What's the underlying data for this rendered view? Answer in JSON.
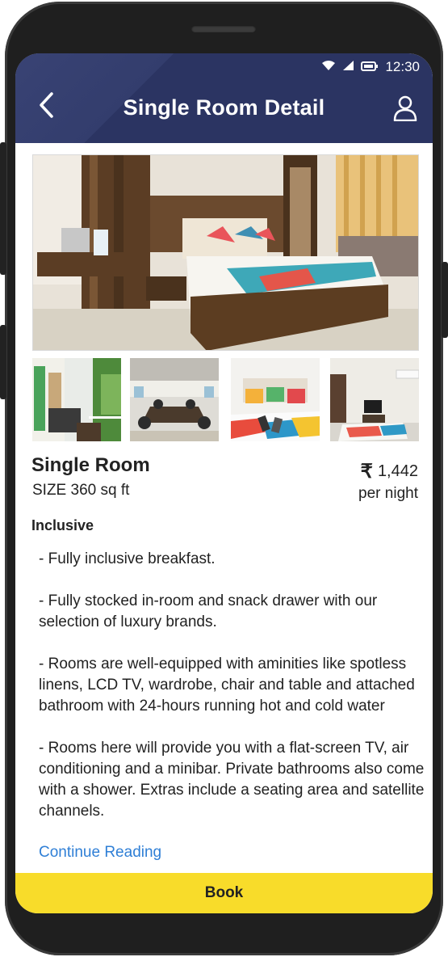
{
  "status_bar": {
    "time": "12:30"
  },
  "header": {
    "title": "Single Room Detail"
  },
  "room": {
    "name": "Single Room",
    "size": "SIZE 360 sq ft",
    "currency_symbol": "₹",
    "price": "1,442",
    "price_unit": "per night"
  },
  "inclusive": {
    "heading": "Inclusive",
    "items": [
      "- Fully inclusive breakfast.",
      "- Fully stocked in-room and snack drawer with our selection of luxury brands.",
      "- Rooms are well-equipped with aminities like spotless linens, LCD TV, wardrobe, chair and table and attached bathroom with 24-hours running hot and cold water",
      "- Rooms here will provide you with a flat-screen TV, air conditioning and a minibar. Private bathrooms also come with a shower. Extras include a seating area and satellite channels."
    ],
    "continue_label": "Continue Reading"
  },
  "footer": {
    "book_label": "Book"
  },
  "colors": {
    "header": "#2b3462",
    "accent_yellow": "#f8dc2a",
    "link_blue": "#2f7fd6"
  },
  "icons": {
    "back": "chevron-left-icon",
    "profile": "user-icon",
    "wifi": "wifi-icon",
    "signal": "signal-icon",
    "battery": "battery-icon"
  }
}
